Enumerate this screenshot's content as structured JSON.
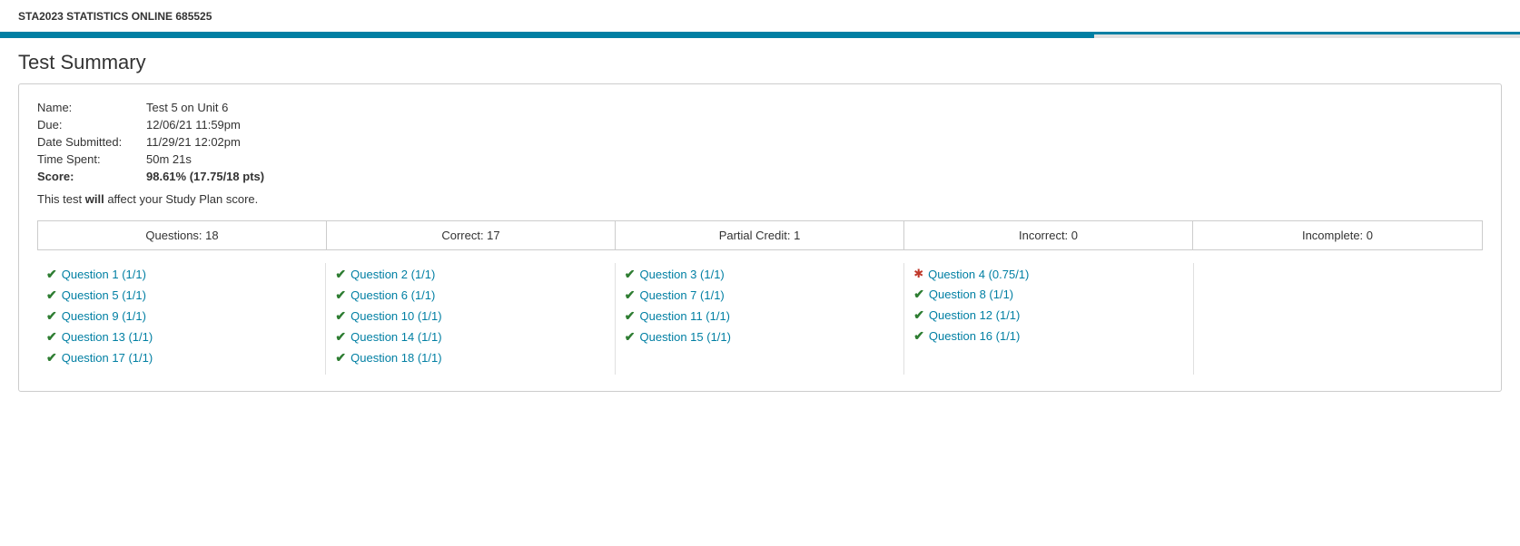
{
  "header": {
    "course_title": "STA2023 STATISTICS ONLINE 685525",
    "progress_percent": 72
  },
  "page": {
    "title": "Test Summary"
  },
  "info": {
    "name_label": "Name:",
    "name_value": "Test 5 on Unit 6",
    "due_label": "Due:",
    "due_value": "12/06/21 11:59pm",
    "date_submitted_label": "Date Submitted:",
    "date_submitted_value": "11/29/21 12:02pm",
    "time_spent_label": "Time Spent:",
    "time_spent_value": "50m 21s",
    "score_label": "Score:",
    "score_value": "98.61% (17.75/18 pts)",
    "study_plan_text_before": "This test ",
    "study_plan_text_bold": "will",
    "study_plan_text_after": " affect your Study Plan score."
  },
  "summary": {
    "questions_label": "Questions: 18",
    "correct_label": "Correct: 17",
    "partial_label": "Partial Credit: 1",
    "incorrect_label": "Incorrect: 0",
    "incomplete_label": "Incomplete: 0"
  },
  "columns": [
    {
      "col_id": "col1",
      "items": [
        {
          "label": "Question 1 (1/1)",
          "status": "correct"
        },
        {
          "label": "Question 5 (1/1)",
          "status": "correct"
        },
        {
          "label": "Question 9 (1/1)",
          "status": "correct"
        },
        {
          "label": "Question 13 (1/1)",
          "status": "correct"
        },
        {
          "label": "Question 17 (1/1)",
          "status": "correct"
        }
      ]
    },
    {
      "col_id": "col2",
      "items": [
        {
          "label": "Question 2 (1/1)",
          "status": "correct"
        },
        {
          "label": "Question 6 (1/1)",
          "status": "correct"
        },
        {
          "label": "Question 10 (1/1)",
          "status": "correct"
        },
        {
          "label": "Question 14 (1/1)",
          "status": "correct"
        },
        {
          "label": "Question 18 (1/1)",
          "status": "correct"
        }
      ]
    },
    {
      "col_id": "col3",
      "items": [
        {
          "label": "Question 3 (1/1)",
          "status": "correct"
        },
        {
          "label": "Question 7 (1/1)",
          "status": "correct"
        },
        {
          "label": "Question 11 (1/1)",
          "status": "correct"
        },
        {
          "label": "Question 15 (1/1)",
          "status": "correct"
        }
      ]
    },
    {
      "col_id": "col4",
      "items": [
        {
          "label": "Question 4 (0.75/1)",
          "status": "partial"
        },
        {
          "label": "Question 8 (1/1)",
          "status": "correct"
        },
        {
          "label": "Question 12 (1/1)",
          "status": "correct"
        },
        {
          "label": "Question 16 (1/1)",
          "status": "correct"
        }
      ]
    },
    {
      "col_id": "col5",
      "items": []
    }
  ],
  "icons": {
    "check": "✔",
    "partial": "✖"
  }
}
